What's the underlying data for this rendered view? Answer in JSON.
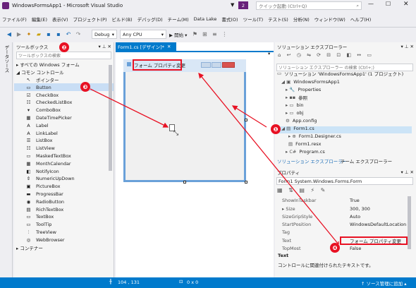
{
  "window": {
    "title": "WindowsFormsApp1 - Microsoft Visual Studio",
    "notification_count": "2",
    "quicklaunch_placeholder": "クイック起動 (Ctrl+Q)"
  },
  "menu": [
    "ファイル(F)",
    "編集(E)",
    "表示(V)",
    "プロジェクト(P)",
    "ビルド(B)",
    "デバッグ(D)",
    "チーム(M)",
    "Data Lake",
    "書式(O)",
    "ツール(T)",
    "テスト(S)",
    "分析(N)",
    "ウィンドウ(W)",
    "ヘルプ(H)"
  ],
  "toolbar": {
    "config": "Debug",
    "platform": "Any CPU",
    "start_label": "▶ 開始 ▾"
  },
  "toolbox": {
    "vert_tab": "データソース",
    "title": "ツールボックス",
    "search_placeholder": "ツールボックスの検索",
    "cat_all": "▸ すべての Windows フォーム",
    "cat_common": "◢ コモン コントロール",
    "cat_container": "▸ コンテナー",
    "items": [
      "ポインター",
      "Button",
      "CheckBox",
      "CheckedListBox",
      "ComboBox",
      "DateTimePicker",
      "Label",
      "LinkLabel",
      "ListBox",
      "ListView",
      "MaskedTextBox",
      "MonthCalendar",
      "NotifyIcon",
      "NumericUpDown",
      "PictureBox",
      "ProgressBar",
      "RadioButton",
      "RichTextBox",
      "TextBox",
      "ToolTip",
      "TreeView",
      "WebBrowser"
    ]
  },
  "designer": {
    "tab_label": "Form1.cs [デザイン]*",
    "form_title": "フォーム プロパティ変更"
  },
  "solution_explorer": {
    "title": "ソリューション エクスプローラー",
    "search_placeholder": "ソリューション エクスプローラー の検索 (Ctrl+;)",
    "nodes": [
      "ソリューション 'WindowsFormsApp1' (1 プロジェクト)",
      "WindowsFormsApp1",
      "Properties",
      "参照",
      "bin",
      "obj",
      "App.config",
      "Form1.cs",
      "Form1.Designer.cs",
      "Form1.resx",
      "Program.cs"
    ],
    "tab_se": "ソリューション エクスプローラー",
    "tab_team": "チーム エクスプローラー"
  },
  "properties": {
    "title": "プロパティ",
    "object": "Form1  System.Windows.Forms.Form",
    "rows": [
      {
        "k": "ShowInTaskbar",
        "v": "True"
      },
      {
        "k": "▸ Size",
        "v": "300, 300"
      },
      {
        "k": "SizeGripStyle",
        "v": "Auto"
      },
      {
        "k": "StartPosition",
        "v": "WindowsDefaultLocation"
      },
      {
        "k": "Tag",
        "v": ""
      },
      {
        "k": "Text",
        "v": "フォーム プロパティ変更"
      },
      {
        "k": "TopMost",
        "v": "False"
      }
    ],
    "desc_title": "Text",
    "desc_text": "コントロールに関連付けられたテキストです。"
  },
  "status": {
    "pos": "104 , 131",
    "size": "0 x 0",
    "source_control": "↑ ソース管理に追加 ▴"
  },
  "badges": [
    "❶",
    "❷",
    "❸",
    "❹"
  ]
}
